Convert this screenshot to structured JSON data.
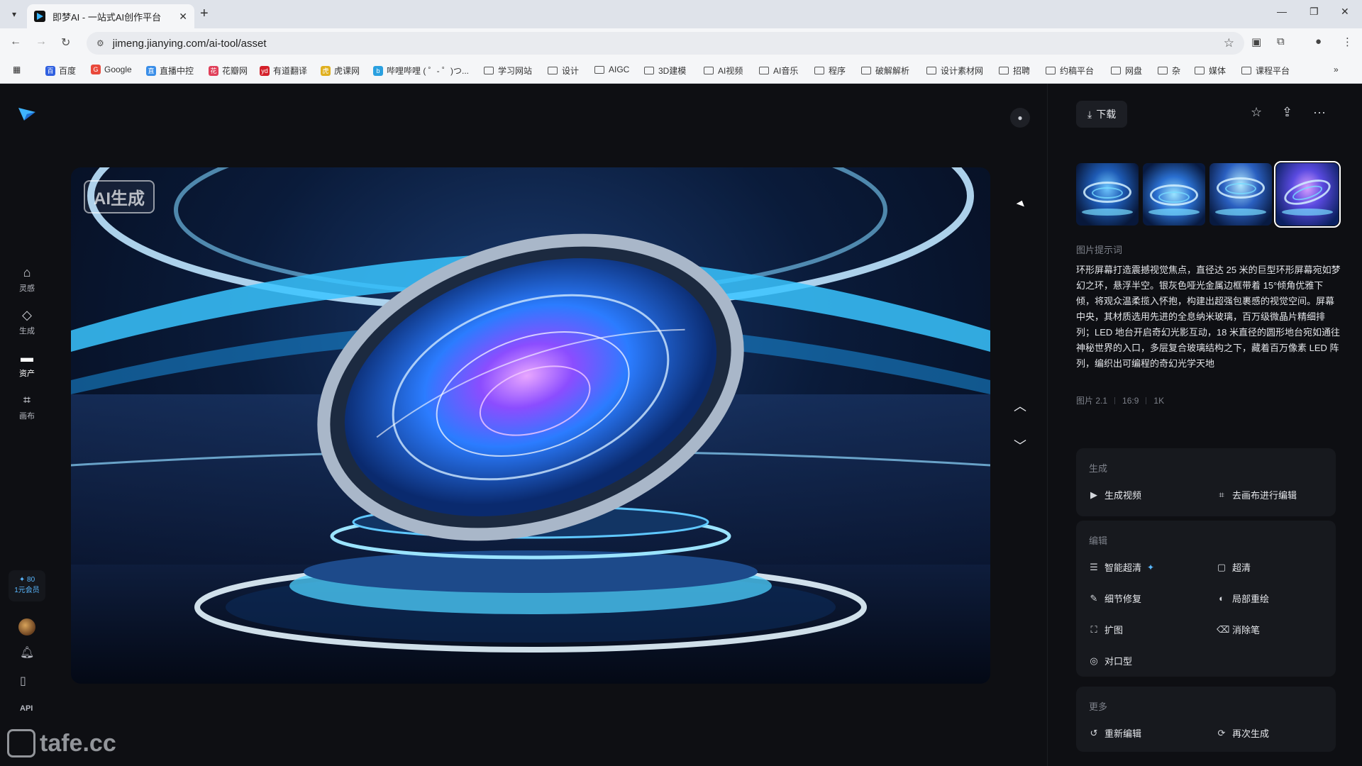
{
  "browser": {
    "tab_title": "即梦AI - 一站式AI创作平台",
    "url": "jimeng.jianying.com/ai-tool/asset",
    "bookmarks": [
      "百度",
      "Google",
      "直播中控",
      "花瓣网",
      "有道翻译",
      "虎课网",
      "哔哩哔哩 ( ゜- ゜)つ...",
      "学习网站",
      "设计",
      "AIGC",
      "3D建模",
      "AI视频",
      "AI音乐",
      "程序",
      "破解解析",
      "设计素材网",
      "招聘",
      "约稿平台",
      "网盘",
      "杂",
      "媒体",
      "课程平台"
    ]
  },
  "nav": {
    "items": [
      {
        "label": "灵感",
        "icon": "home-icon"
      },
      {
        "label": "生成",
        "icon": "diamond-icon"
      },
      {
        "label": "资产",
        "icon": "folder-icon"
      },
      {
        "label": "画布",
        "icon": "crop-icon"
      }
    ],
    "vip_line1": "✦ 80",
    "vip_line2": "1元会员",
    "api_label": "API"
  },
  "watermark": "tafe.cc",
  "image": {
    "badge": "AI生成"
  },
  "panel": {
    "download_label": "下载",
    "prompt_label": "图片提示词",
    "prompt_text": "环形屏幕打造震撼视觉焦点，直径达 25 米的巨型环形屏幕宛如梦幻之环，悬浮半空。银灰色哑光金属边框带着 15°倾角优雅下倾，将观众温柔揽入怀抱，构建出超强包裹感的视觉空间。屏幕中央，其材质选用先进的全息纳米玻璃，百万级微晶片精细排列；LED 地台开启奇幻光影互动，18 米直径的圆形地台宛如通往神秘世界的入口，多层复合玻璃结构之下，藏着百万像素 LED 阵列，编织出可编程的奇幻光学天地",
    "meta": [
      "图片 2.1",
      "16:9",
      "1K"
    ],
    "sections": {
      "generate": {
        "title": "生成",
        "actions": [
          {
            "label": "生成视频",
            "icon": "play-icon"
          },
          {
            "label": "去画布进行编辑",
            "icon": "crop-icon"
          }
        ]
      },
      "edit": {
        "title": "编辑",
        "actions": [
          {
            "label": "智能超清",
            "icon": "hd-icon"
          },
          {
            "label": "超清",
            "icon": "hd-box-icon"
          },
          {
            "label": "细节修复",
            "icon": "wand-icon"
          },
          {
            "label": "局部重绘",
            "icon": "palette-icon"
          },
          {
            "label": "扩图",
            "icon": "expand-icon"
          },
          {
            "label": "消除笔",
            "icon": "eraser-icon"
          },
          {
            "label": "对口型",
            "icon": "lips-icon"
          }
        ]
      },
      "more": {
        "title": "更多",
        "actions": [
          {
            "label": "重新编辑",
            "icon": "edit-icon"
          },
          {
            "label": "再次生成",
            "icon": "refresh-icon"
          }
        ]
      }
    }
  }
}
